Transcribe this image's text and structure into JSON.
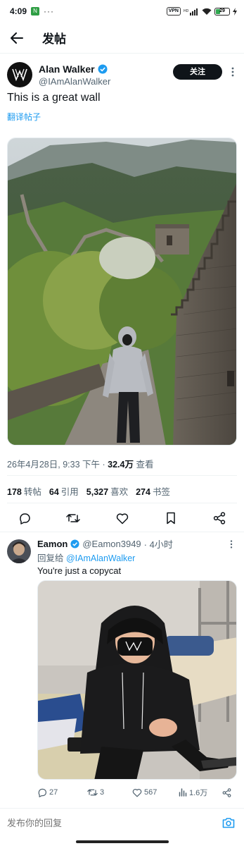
{
  "status_bar": {
    "time": "4:09",
    "app_badge": "N",
    "dots": "···",
    "vpn": "VPN",
    "battery": "29"
  },
  "header": {
    "title": "发帖"
  },
  "tweet": {
    "author_name": "Alan Walker",
    "author_handle": "@IAmAlanWalker",
    "follow_label": "关注",
    "text": "This is a great wall",
    "translate_label": "翻译帖子",
    "timestamp": "26年4月28日, 9:33 下午 · ",
    "views_count": "32.4万",
    "views_label": " 查看",
    "stats": [
      {
        "count": "178",
        "label": "转帖"
      },
      {
        "count": "64",
        "label": "引用"
      },
      {
        "count": "5,327",
        "label": "喜欢"
      },
      {
        "count": "274",
        "label": "书签"
      }
    ]
  },
  "reply": {
    "author_name": "Eamon",
    "author_handle": "@Eamon3949",
    "time": "· 4小时",
    "reply_to_prefix": "回复给 ",
    "reply_to_handle": "@IAmAlanWalker",
    "text": "You're just a copycat",
    "actions": {
      "replies": "27",
      "retweets": "3",
      "likes": "567",
      "views": "1.6万"
    }
  },
  "composer": {
    "placeholder": "发布你的回复"
  },
  "colors": {
    "accent": "#1d9bf0",
    "text": "#0f1419",
    "muted": "#536471",
    "verified": "#1d9bf0"
  }
}
